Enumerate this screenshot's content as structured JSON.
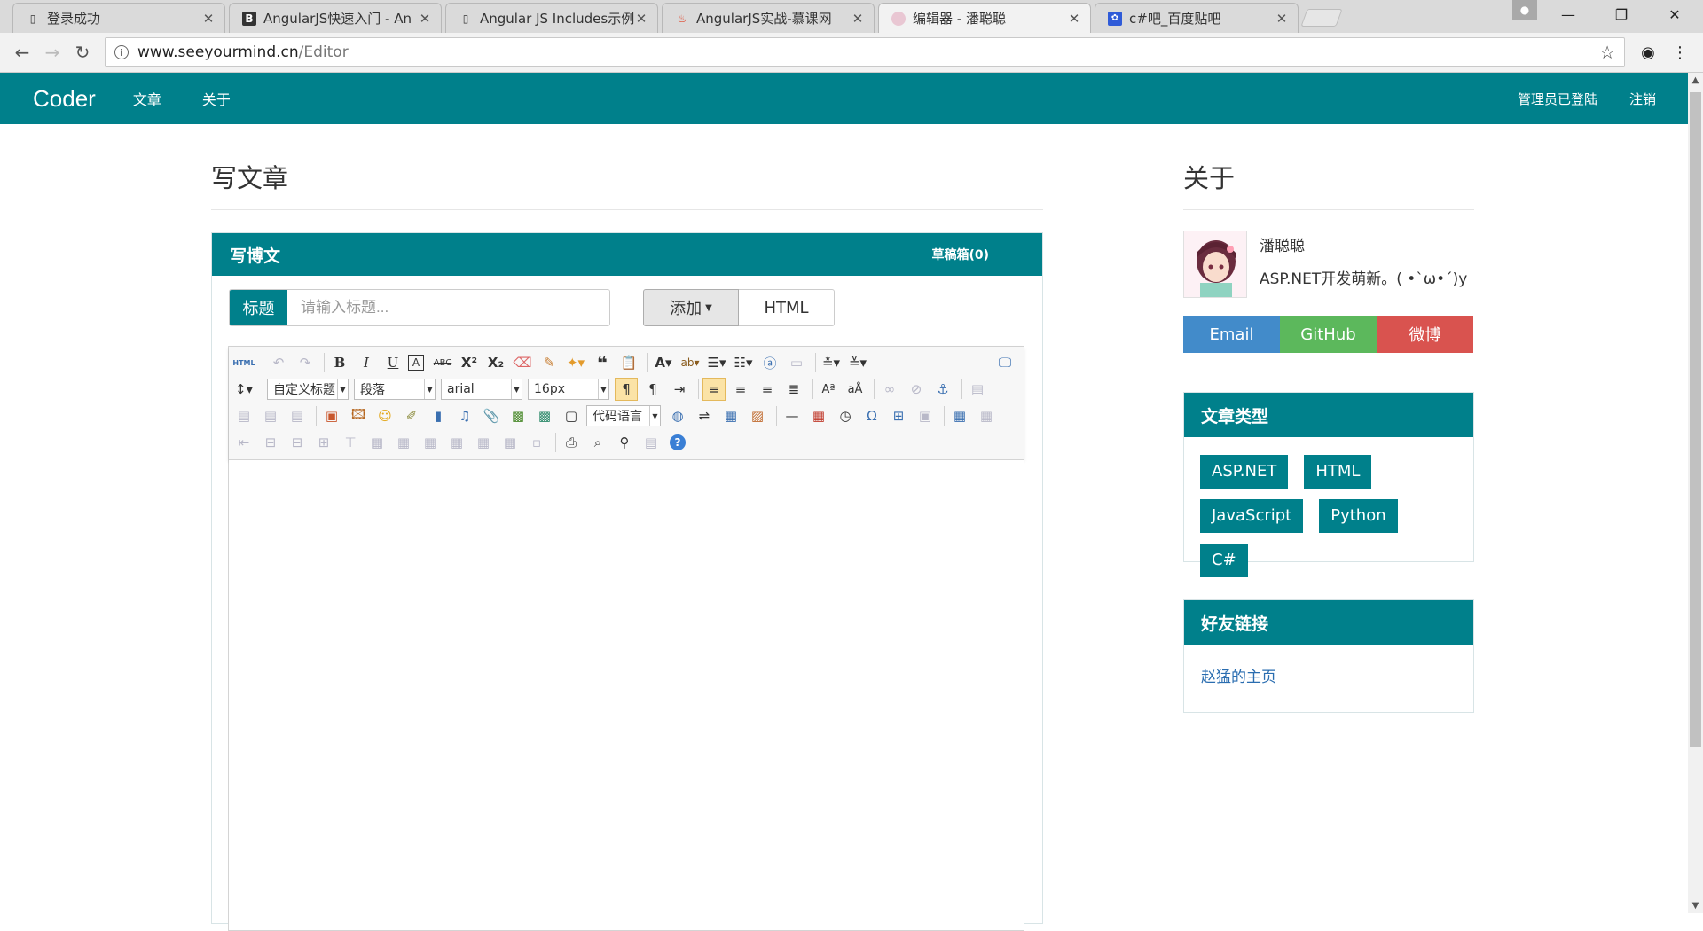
{
  "browser": {
    "tabs": [
      {
        "title": "登录成功",
        "icon": "page-icon"
      },
      {
        "title": "AngularJS快速入门 - An",
        "icon": "b-logo-icon"
      },
      {
        "title": "Angular JS Includes示例",
        "icon": "page-icon"
      },
      {
        "title": "AngularJS实战-慕课网",
        "icon": "flame-icon"
      },
      {
        "title": "编辑器 - 潘聪聪",
        "icon": "avatar-icon"
      },
      {
        "title": "c#吧_百度贴吧",
        "icon": "paw-icon"
      }
    ],
    "active_tab": 4,
    "url_host": "www.seeyourmind.cn",
    "url_path": "/Editor"
  },
  "navbar": {
    "brand": "Coder",
    "links": [
      "文章",
      "关于"
    ],
    "right": [
      "管理员已登陆",
      "注销"
    ]
  },
  "main": {
    "title": "写文章",
    "panel_title": "写博文",
    "drafts": "草稿箱(0)",
    "title_label": "标题",
    "title_placeholder": "请输入标题...",
    "add_button": "添加",
    "html_button": "HTML",
    "editor": {
      "format_style": "自定义标题",
      "paragraph": "段落",
      "font_family": "arial",
      "font_size": "16px",
      "code_language": "代码语言",
      "html_icon_label": "HTML"
    }
  },
  "sidebar": {
    "title": "关于",
    "profile_name": "潘聪聪",
    "profile_desc": "ASP.NET开发萌新。( •`ω•´)y",
    "social": [
      {
        "label": "Email",
        "color": "#428bca"
      },
      {
        "label": "GitHub",
        "color": "#5cb85c"
      },
      {
        "label": "微博",
        "color": "#d9534f"
      }
    ],
    "categories_title": "文章类型",
    "categories": [
      "ASP.NET",
      "HTML",
      "JavaScript",
      "Python",
      "C#"
    ],
    "friends_title": "好友链接",
    "friends": [
      "赵猛的主页"
    ]
  },
  "colors": {
    "brand": "#00808b"
  }
}
